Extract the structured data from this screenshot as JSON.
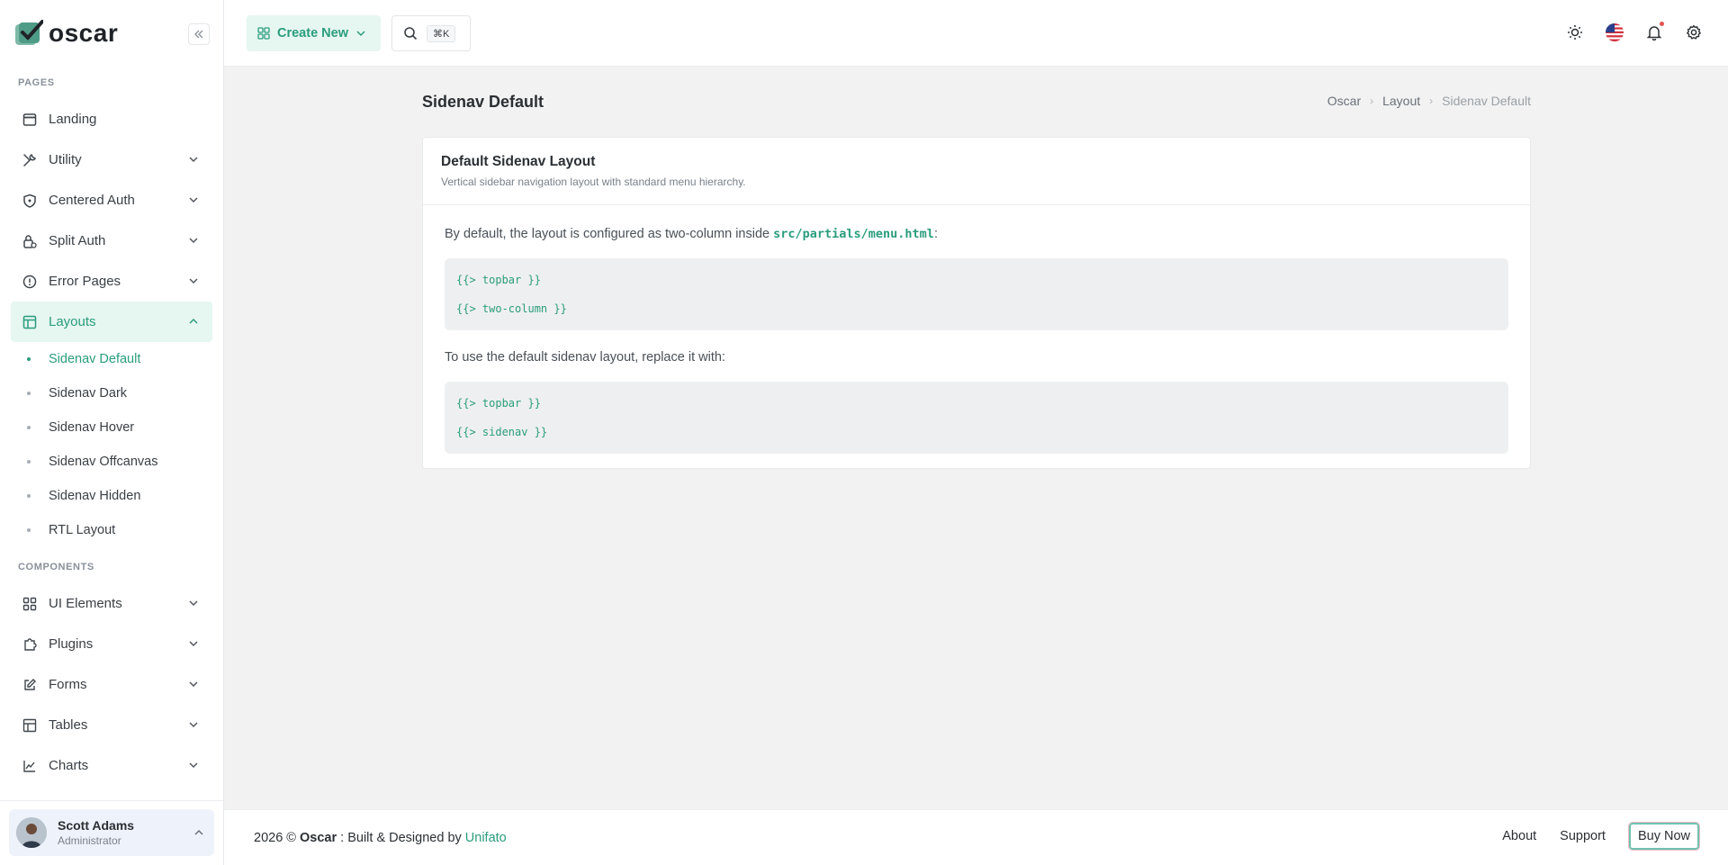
{
  "brand": {
    "name": "oscar",
    "collapse_icon": "chevrons-left-icon"
  },
  "sidebar": {
    "sections": {
      "pages": "PAGES",
      "components": "COMPONENTS"
    },
    "pages_items": [
      {
        "label": "Landing",
        "icon": "window-icon"
      },
      {
        "label": "Utility",
        "icon": "tools-icon"
      },
      {
        "label": "Centered Auth",
        "icon": "shield-icon"
      },
      {
        "label": "Split Auth",
        "icon": "lock-icon"
      },
      {
        "label": "Error Pages",
        "icon": "alert-circle-icon"
      },
      {
        "label": "Layouts",
        "icon": "layout-icon"
      }
    ],
    "layouts_sub": [
      "Sidenav Default",
      "Sidenav Dark",
      "Sidenav Hover",
      "Sidenav Offcanvas",
      "Sidenav Hidden",
      "RTL Layout"
    ],
    "component_items": [
      {
        "label": "UI Elements",
        "icon": "grid-icon"
      },
      {
        "label": "Plugins",
        "icon": "puzzle-icon"
      },
      {
        "label": "Forms",
        "icon": "edit-icon"
      },
      {
        "label": "Tables",
        "icon": "table-icon"
      },
      {
        "label": "Charts",
        "icon": "chart-icon"
      }
    ],
    "user": {
      "name": "Scott Adams",
      "role": "Administrator"
    }
  },
  "topbar": {
    "create_label": "Create New",
    "search_kbd": "⌘K"
  },
  "page": {
    "title": "Sidenav Default",
    "breadcrumb": [
      "Oscar",
      "Layout",
      "Sidenav Default"
    ]
  },
  "card": {
    "title": "Default Sidenav Layout",
    "subtitle": "Vertical sidebar navigation layout with standard menu hierarchy.",
    "para1_prefix": "By default, the layout is configured as two-column inside ",
    "para1_code": "src/partials/menu.html",
    "para1_suffix": ":",
    "code1": [
      "{{> topbar }}",
      "{{> two-column }}"
    ],
    "para2": "To use the default sidenav layout, replace it with:",
    "code2": [
      "{{> topbar }}",
      "{{> sidenav }}"
    ]
  },
  "footer": {
    "year": "2026 © ",
    "brand": "Oscar",
    "middle": " : Built & Designed by ",
    "author": "Unifato",
    "about": "About",
    "support": "Support",
    "buy": "Buy Now"
  },
  "colors": {
    "accent": "#2a9d7c",
    "accent_bg": "#e6f6f1"
  }
}
